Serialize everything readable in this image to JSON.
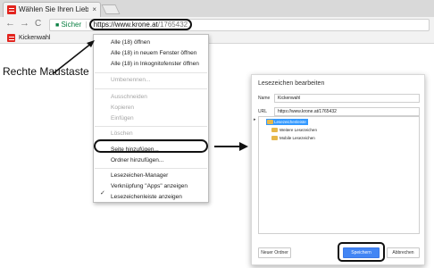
{
  "browser": {
    "tab_title": "Wählen Sie Ihren Liebling",
    "tab_close": "×",
    "nav_back": "←",
    "nav_forward": "→",
    "nav_reload": "C",
    "secure_label": "Sicher",
    "separator": "|",
    "url_host": "https://www.krone.at",
    "url_path": "/1765432",
    "bookmark_label": "Kickenwahl"
  },
  "context_menu": {
    "items": [
      {
        "label": "Alle (18) öffnen",
        "enabled": true
      },
      {
        "label": "Alle (18) in neuem Fenster öffnen",
        "enabled": true
      },
      {
        "label": "Alle (18) in Inkognitofenster öffnen",
        "enabled": true
      },
      {
        "label": "Umbenennen...",
        "enabled": false
      },
      {
        "label": "Ausschneiden",
        "enabled": false
      },
      {
        "label": "Kopieren",
        "enabled": false
      },
      {
        "label": "Einfügen",
        "enabled": false
      },
      {
        "label": "Löschen",
        "enabled": false
      },
      {
        "label": "Seite hinzufügen...",
        "enabled": true
      },
      {
        "label": "Ordner hinzufügen...",
        "enabled": true
      },
      {
        "label": "Lesezeichen-Manager",
        "enabled": true
      },
      {
        "label": "Verknüpfung \"Apps\" anzeigen",
        "enabled": true
      },
      {
        "label": "Lesezeichenleiste anzeigen",
        "enabled": true,
        "checked": true
      }
    ],
    "check_mark": "✓"
  },
  "annotation": {
    "caption": "Rechte Maustaste"
  },
  "dialog": {
    "title": "Lesezeichen bearbeiten",
    "name_label": "Name",
    "name_value": "Kickenwahl",
    "url_label": "URL",
    "url_value": "https://www.krone.at/1765432",
    "expander": "▸",
    "folders": [
      "Lesezeichenleiste",
      "Weitere Lesezeichen",
      "Mobile Lesezeichen"
    ],
    "new_folder_button": "Neuer Ordner",
    "save_button": "Speichern",
    "cancel_button": "Abbrechen"
  },
  "colors": {
    "brand_red": "#e2241e",
    "secure_green": "#0b8043",
    "primary_blue": "#4285f4",
    "folder_yellow": "#e6b84a",
    "selection_blue": "#3399ff"
  }
}
